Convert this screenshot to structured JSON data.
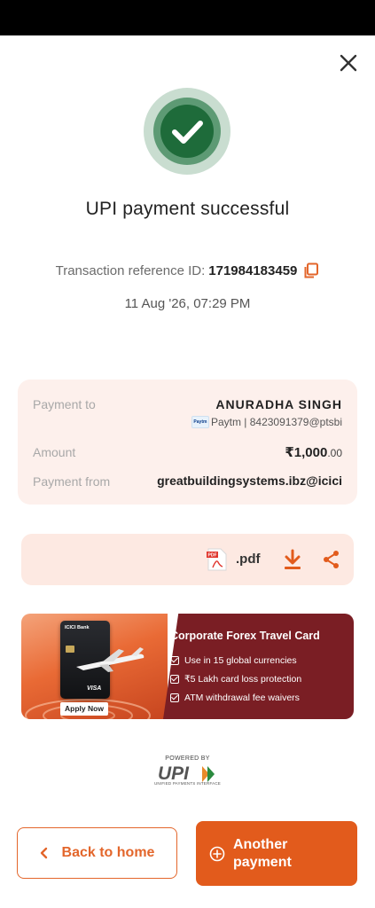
{
  "header": {
    "close_icon": "close-icon"
  },
  "status": {
    "icon": "check-circle-icon",
    "title": "UPI payment successful",
    "accent_color": "#1e6b3a"
  },
  "transaction": {
    "ref_label": "Transaction reference ID:",
    "ref_id": "171984183459",
    "copy_icon": "copy-icon",
    "datetime": "11 Aug '26, 07:29 PM"
  },
  "details": {
    "payment_to_label": "Payment to",
    "payee_name": "ANURADHA  SINGH",
    "payee_badge": "Paytm",
    "payee_handle": "Paytm | 8423091379@ptsbi",
    "amount_label": "Amount",
    "amount_main": "₹1,000",
    "amount_paise": ".00",
    "payment_from_label": "Payment from",
    "payment_from_value": "greatbuildingsystems.ibz@icici"
  },
  "attachment": {
    "file_label": ".pdf",
    "pdf_icon": "pdf-file-icon",
    "download_icon": "download-icon",
    "share_icon": "share-icon"
  },
  "banner": {
    "bank": "ICICI Bank",
    "network": "VISA",
    "apply_label": "Apply Now",
    "title": "Corporate Forex Travel Card",
    "bullets": [
      "Use in 15 global currencies",
      "₹5 Lakh card loss protection",
      "ATM withdrawal fee waivers"
    ]
  },
  "footer": {
    "powered_by": "POWERED BY",
    "upi_logo": "UPI",
    "upi_sub": "UNIFIED PAYMENTS INTERFACE"
  },
  "actions": {
    "back_label": "Back to home",
    "another_label": "Another payment"
  },
  "colors": {
    "brand_orange": "#e25b1c",
    "card_bg": "#fdf0ec",
    "banner_maroon": "#7a1e24"
  }
}
